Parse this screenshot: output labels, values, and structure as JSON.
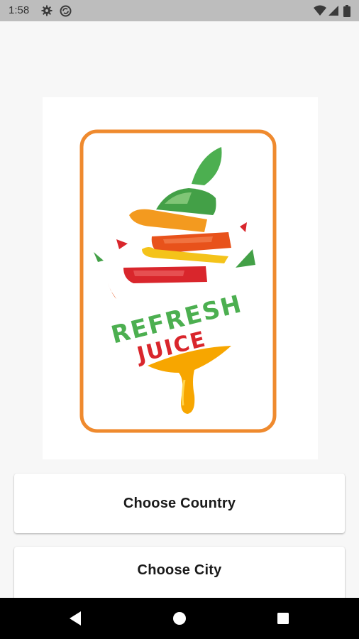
{
  "status_bar": {
    "time": "1:58",
    "icons": [
      "gear-icon",
      "sync-icon",
      "wifi-icon",
      "signal-icon",
      "battery-icon"
    ]
  },
  "logo": {
    "line1": "REFRESH",
    "line2": "JUICE",
    "colors": {
      "frame": "#ef8a2e",
      "green": "#4caf50",
      "red": "#d9262c",
      "orange": "#f39a1f",
      "yellow": "#f4c31a",
      "drip": "#f7a600"
    }
  },
  "buttons": {
    "country": "Choose Country",
    "city": "Choose City"
  },
  "nav": [
    "back-icon",
    "home-icon",
    "recents-icon"
  ]
}
